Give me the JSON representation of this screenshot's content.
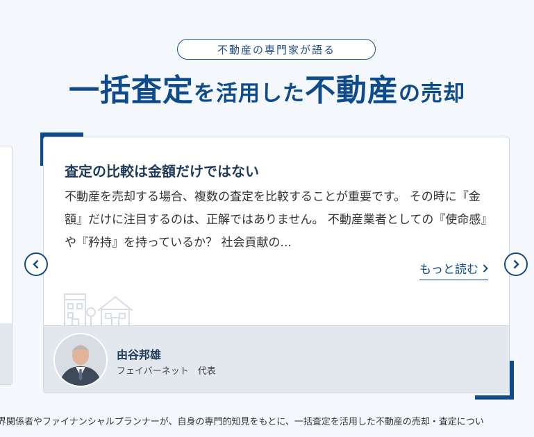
{
  "header": {
    "pill": "不動産の専門家が語る",
    "headline": {
      "part1": "一括査定",
      "part2": "を活用した",
      "part3": "不動産",
      "part4": "の売却"
    }
  },
  "card": {
    "title": "査定の比較は金額だけではない",
    "body": "不動産を売却する場合、複数の査定を比較することが重要です。 その時に『金額』だけに注目するのは、正解ではありません。 不動産業者としての『使命感』や『矜持』を持っているか？ 社会貢献の...",
    "read_more": "もっと読む",
    "author": {
      "name": "由谷邦雄",
      "role": "フェイバーネット　代表"
    }
  },
  "colors": {
    "accent": "#0f4a8a",
    "text": "#1f3a5a",
    "footer_bg": "#e3e8ee",
    "page_bg": "#f4f7fb"
  },
  "icons": {
    "prev": "chevron-left-icon",
    "next": "chevron-right-icon",
    "read_more": "chevron-right-icon"
  },
  "footer_text": "界関係者やファイナンシャルプランナーが、自身の専門的知見をもとに、一括査定を活用した不動産の売却・査定につい"
}
